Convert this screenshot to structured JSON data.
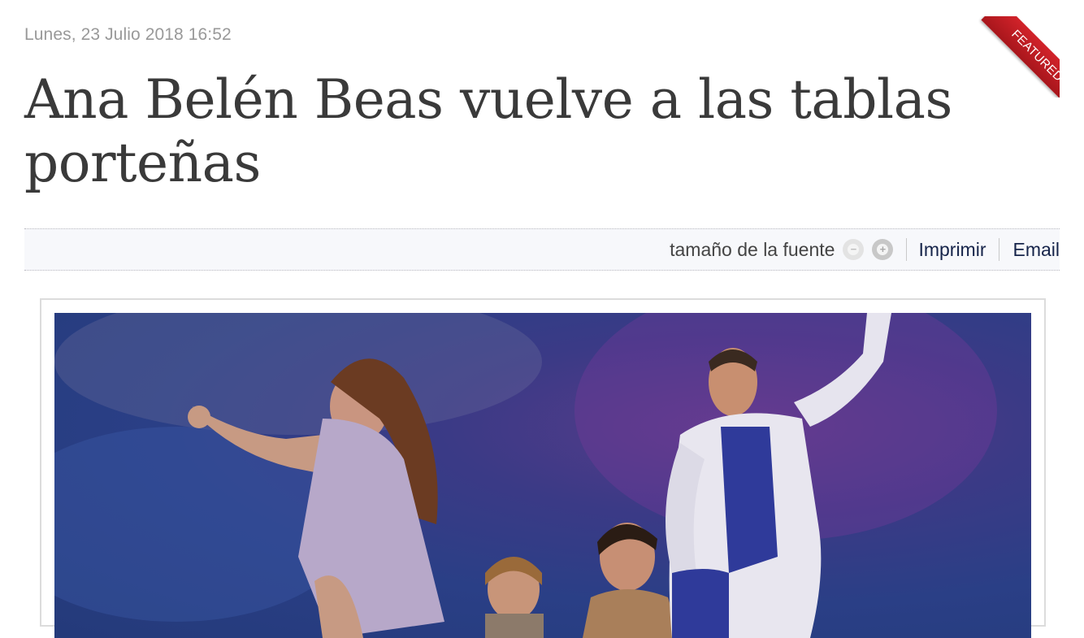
{
  "article": {
    "date": "Lunes, 23 Julio 2018 16:52",
    "title": "Ana Belén Beas vuelve a las tablas porteñas",
    "badge": "FEATURED"
  },
  "tools": {
    "font_size_label": "tamaño de la fuente",
    "decrease_icon": "minus-circle-icon",
    "increase_icon": "plus-circle-icon",
    "print_label": "Imprimir",
    "email_label": "Email"
  },
  "image": {
    "description_icon": "theater-cast-photo"
  },
  "colors": {
    "badge": "#c61e25",
    "title": "#3a3a3a",
    "link": "#16244a"
  }
}
